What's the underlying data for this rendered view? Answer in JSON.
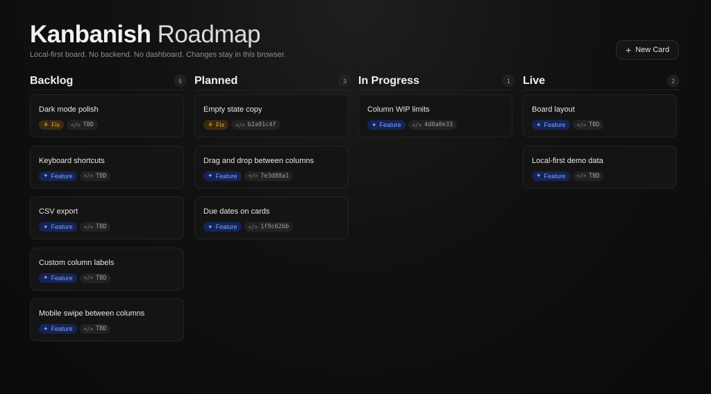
{
  "header": {
    "title_bold": "Kanbanish",
    "title_light": "Roadmap",
    "subtitle": "Local-first board. No backend. No dashboard. Changes stay in this browser."
  },
  "toolbar": {
    "new_card_label": "New Card",
    "new_card_icon": "plus-icon"
  },
  "colors": {
    "feature": "#7ea2ff",
    "fix": "#e6a344",
    "background": "#0b0b0b"
  },
  "columns": [
    {
      "title": "Backlog",
      "count": "5",
      "cards": [
        {
          "title": "Dark mode polish",
          "tag": "Fix",
          "tag_icon": "bug-icon",
          "ref": "TBD"
        },
        {
          "title": "Keyboard shortcuts",
          "tag": "Feature",
          "tag_icon": "sparkle-icon",
          "ref": "TBD"
        },
        {
          "title": "CSV export",
          "tag": "Feature",
          "tag_icon": "sparkle-icon",
          "ref": "TBD"
        },
        {
          "title": "Custom column labels",
          "tag": "Feature",
          "tag_icon": "sparkle-icon",
          "ref": "TBD"
        },
        {
          "title": "Mobile swipe between columns",
          "tag": "Feature",
          "tag_icon": "sparkle-icon",
          "ref": "TBD"
        }
      ]
    },
    {
      "title": "Planned",
      "count": "3",
      "cards": [
        {
          "title": "Empty state copy",
          "tag": "Fix",
          "tag_icon": "bug-icon",
          "ref": "b2a91c4f"
        },
        {
          "title": "Drag and drop between columns",
          "tag": "Feature",
          "tag_icon": "sparkle-icon",
          "ref": "7e3d88a1"
        },
        {
          "title": "Due dates on cards",
          "tag": "Feature",
          "tag_icon": "sparkle-icon",
          "ref": "1f9c62bb"
        }
      ]
    },
    {
      "title": "In Progress",
      "count": "1",
      "cards": [
        {
          "title": "Column WIP limits",
          "tag": "Feature",
          "tag_icon": "sparkle-icon",
          "ref": "4d8a0e33"
        }
      ]
    },
    {
      "title": "Live",
      "count": "2",
      "cards": [
        {
          "title": "Board layout",
          "tag": "Feature",
          "tag_icon": "sparkle-icon",
          "ref": "TBD"
        },
        {
          "title": "Local-first demo data",
          "tag": "Feature",
          "tag_icon": "sparkle-icon",
          "ref": "TBD"
        }
      ]
    }
  ]
}
